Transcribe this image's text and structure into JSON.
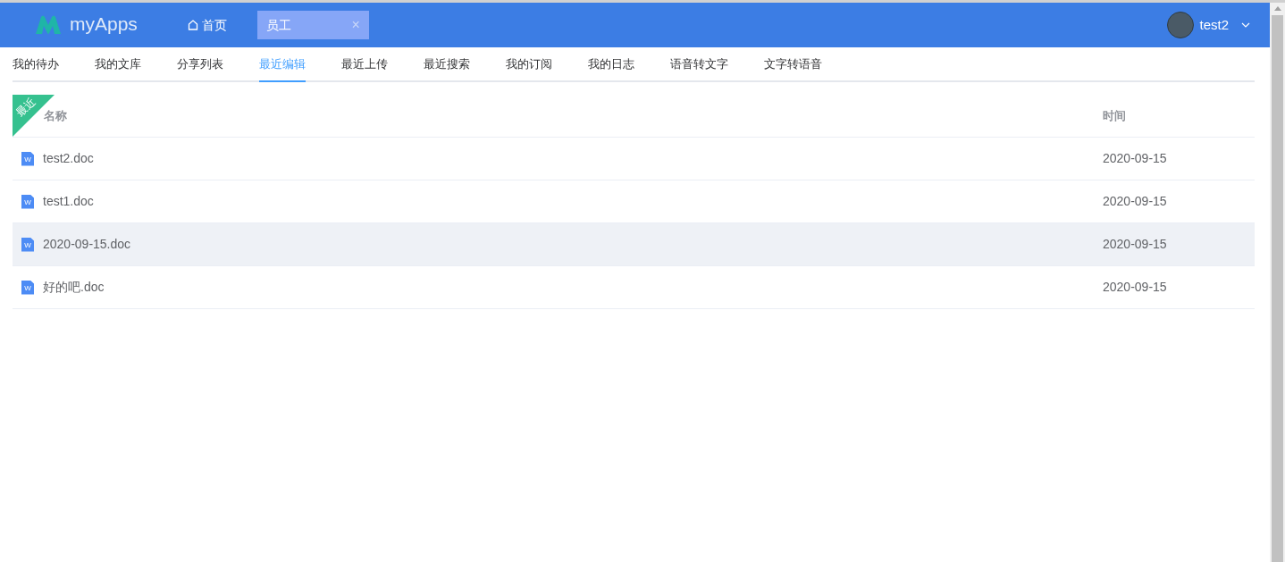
{
  "header": {
    "logo_text": "myApps",
    "home_tab": {
      "label": "首页",
      "selected": false
    },
    "open_tab": {
      "label": "员工",
      "selected": true,
      "close": "×"
    },
    "user": {
      "name": "test2"
    }
  },
  "nav_tabs": [
    {
      "label": "我的待办",
      "selected": false
    },
    {
      "label": "我的文库",
      "selected": false
    },
    {
      "label": "分享列表",
      "selected": false
    },
    {
      "label": "最近编辑",
      "selected": true
    },
    {
      "label": "最近上传",
      "selected": false
    },
    {
      "label": "最近搜索",
      "selected": false
    },
    {
      "label": "我的订阅",
      "selected": false
    },
    {
      "label": "我的日志",
      "selected": false
    },
    {
      "label": "语音转文字",
      "selected": false
    },
    {
      "label": "文字转语音",
      "selected": false
    }
  ],
  "table": {
    "ribbon": "最近",
    "columns": [
      "名称",
      "时间"
    ],
    "rows": [
      {
        "icon_label": "W",
        "name": "test2.doc",
        "time": "2020-09-15",
        "selected": false
      },
      {
        "icon_label": "W",
        "name": "test1.doc",
        "time": "2020-09-15",
        "selected": false
      },
      {
        "icon_label": "W",
        "name": "2020-09-15.doc",
        "time": "2020-09-15",
        "selected": true
      },
      {
        "icon_label": "W",
        "name": "好的吧.doc",
        "time": "2020-09-15",
        "selected": false
      }
    ]
  }
}
